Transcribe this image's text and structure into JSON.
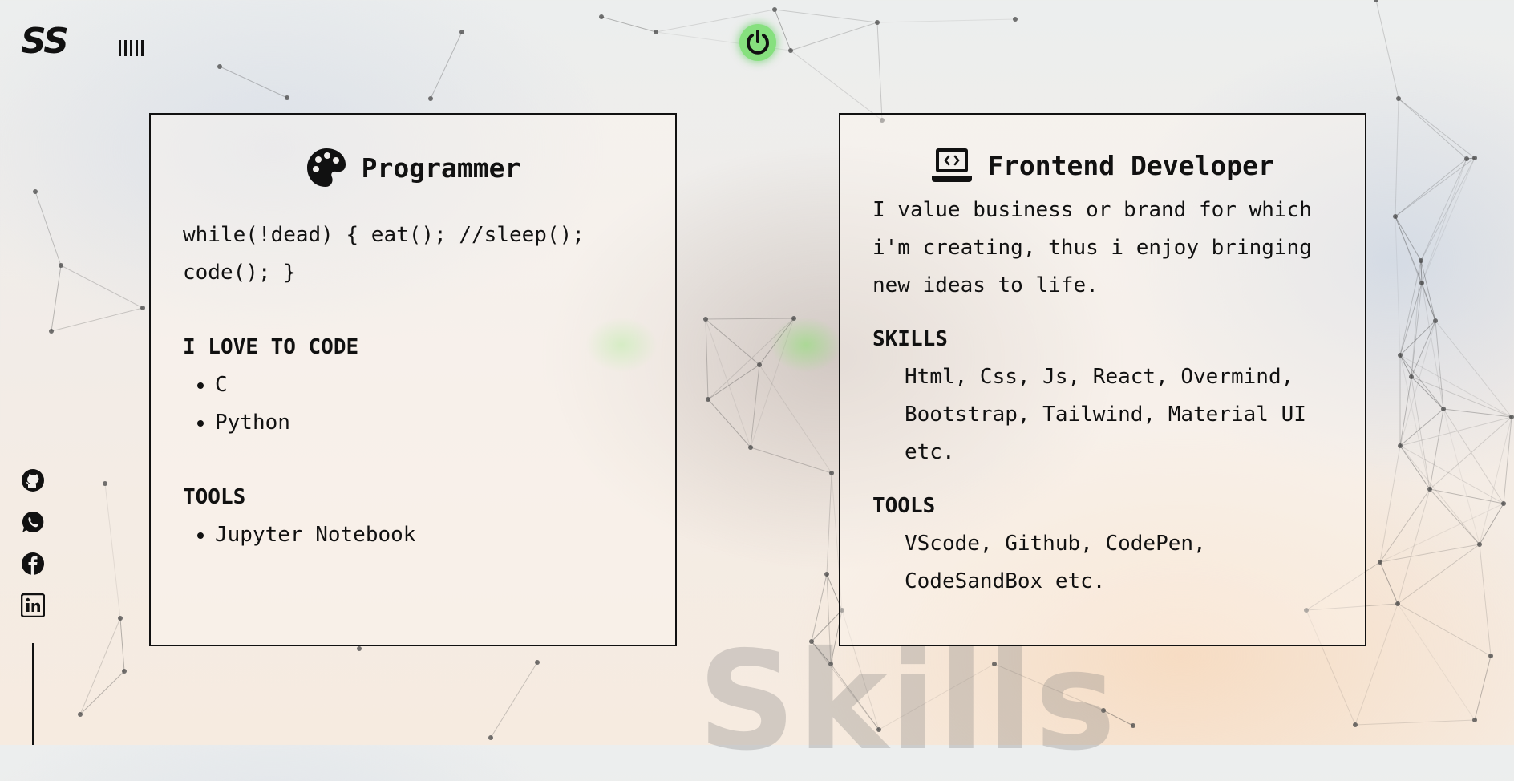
{
  "header": {
    "logo": "SS",
    "menu_icon": "menu-bars-icon",
    "power_icon": "power-icon",
    "accent": "#86e07e"
  },
  "socials": [
    {
      "name": "github",
      "icon": "github-icon"
    },
    {
      "name": "whatsapp",
      "icon": "whatsapp-icon"
    },
    {
      "name": "facebook",
      "icon": "facebook-icon"
    },
    {
      "name": "linkedin",
      "icon": "linkedin-icon"
    }
  ],
  "background_word": "Skills",
  "cards": {
    "programmer": {
      "icon": "palette-icon",
      "title": "Programmer",
      "code_line_1": "while(!dead) { eat(); //sleep();",
      "code_line_2": "code(); }",
      "love_title": "I LOVE TO CODE",
      "languages": [
        "C",
        "Python"
      ],
      "tools_title": "TOOLS",
      "tools": [
        "Jupyter Notebook"
      ]
    },
    "frontend": {
      "icon": "laptop-code-icon",
      "title": "Frontend Developer",
      "desc_line_1": "I value business or brand for which",
      "desc_line_2": "i'm creating, thus i enjoy bringing",
      "desc_line_3": "new ideas to life.",
      "skills_title": "SKILLS",
      "skills_line_1": "Html, Css, Js, React, Overmind,",
      "skills_line_2": "Bootstrap, Tailwind, Material UI",
      "skills_line_3": "etc.",
      "tools_title": "TOOLS",
      "tools_line_1": "VScode, Github, CodePen,",
      "tools_line_2": "CodeSandBox etc."
    }
  }
}
